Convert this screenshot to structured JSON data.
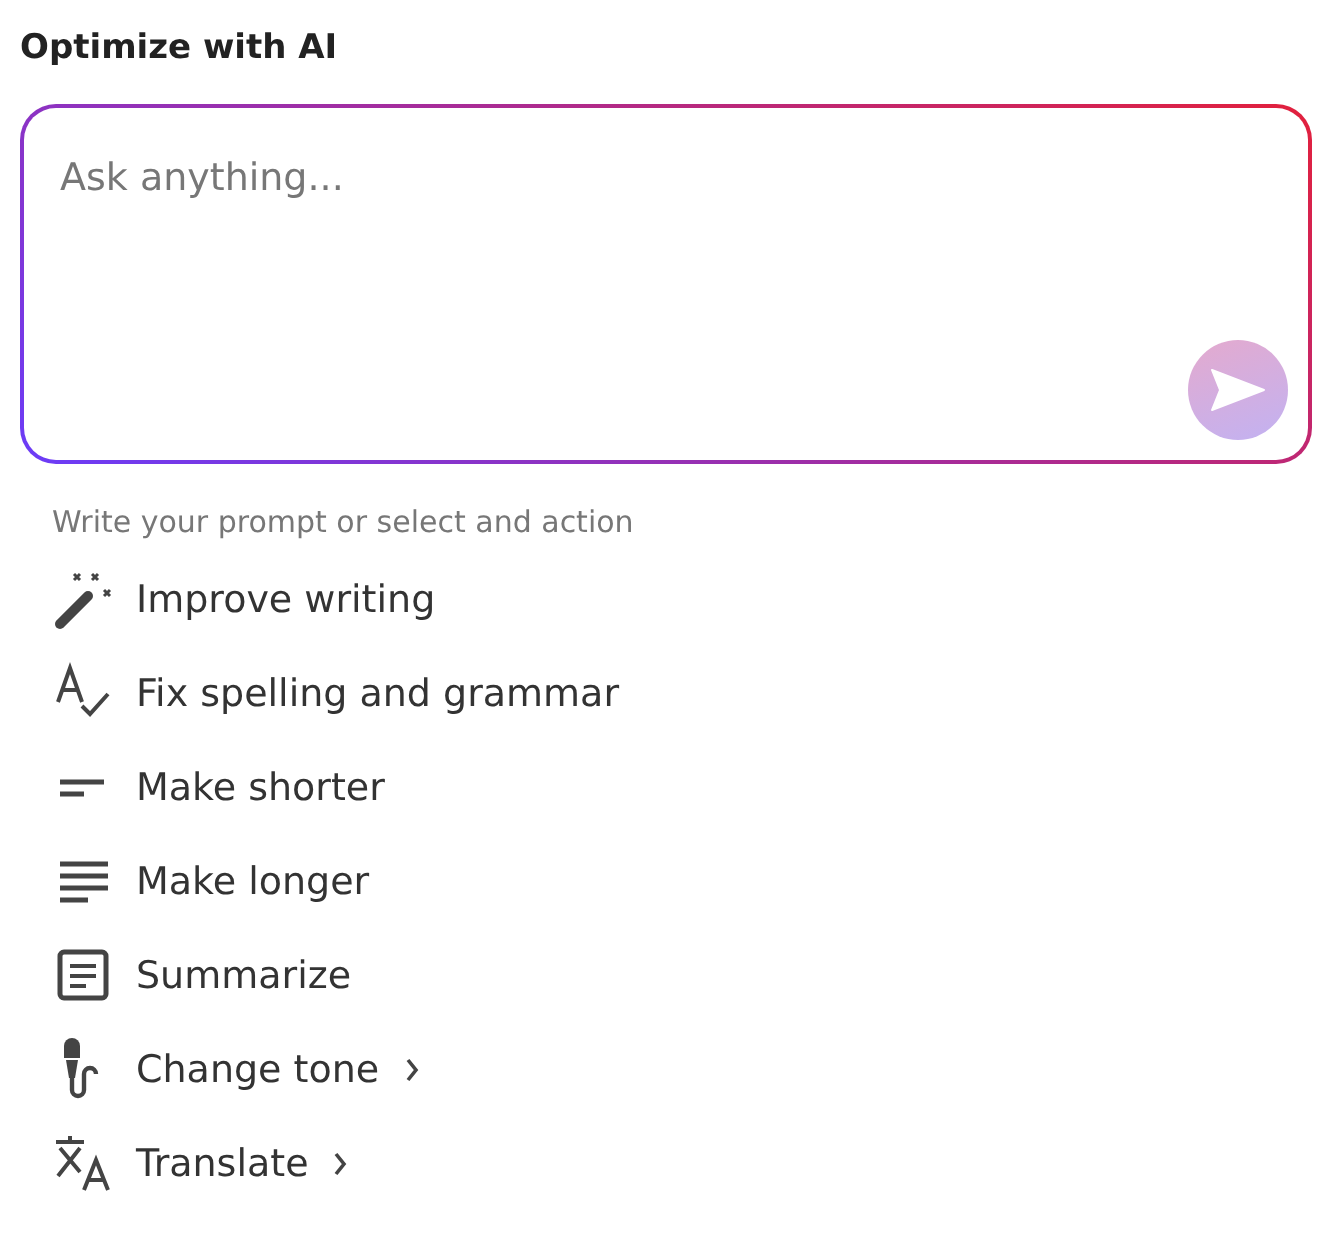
{
  "title": "Optimize with AI",
  "prompt": {
    "placeholder": "Ask anything..."
  },
  "hint": "Write your prompt or select and action",
  "actions": [
    {
      "label": "Improve writing",
      "kind": "wand",
      "submenu": false
    },
    {
      "label": "Fix spelling and grammar",
      "kind": "spellcheck",
      "submenu": false
    },
    {
      "label": "Make shorter",
      "kind": "short",
      "submenu": false
    },
    {
      "label": "Make longer",
      "kind": "long",
      "submenu": false
    },
    {
      "label": "Summarize",
      "kind": "summary",
      "submenu": false
    },
    {
      "label": "Change tone",
      "kind": "mic",
      "submenu": true
    },
    {
      "label": "Translate",
      "kind": "translate",
      "submenu": true
    }
  ]
}
